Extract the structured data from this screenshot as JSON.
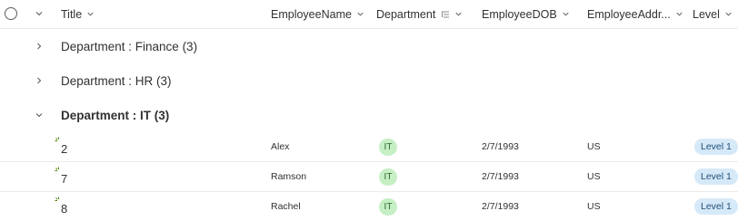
{
  "header": {
    "columns": [
      {
        "key": "title",
        "label": "Title"
      },
      {
        "key": "employee_name",
        "label": "EmployeeName"
      },
      {
        "key": "department",
        "label": "Department"
      },
      {
        "key": "employee_dob",
        "label": "EmployeeDOB"
      },
      {
        "key": "employee_address",
        "label": "EmployeeAddr..."
      },
      {
        "key": "level",
        "label": "Level"
      }
    ]
  },
  "groups": [
    {
      "label": "Department : Finance (3)",
      "expanded": false
    },
    {
      "label": "Department : HR (3)",
      "expanded": false
    },
    {
      "label": "Department : IT (3)",
      "expanded": true
    }
  ],
  "rows": [
    {
      "title": "2",
      "employee_name": "Alex",
      "department": "IT",
      "employee_dob": "2/7/1993",
      "employee_address": "US",
      "level": "Level 1"
    },
    {
      "title": "7",
      "employee_name": "Ramson",
      "department": "IT",
      "employee_dob": "2/7/1993",
      "employee_address": "US",
      "level": "Level 1"
    },
    {
      "title": "8",
      "employee_name": "Rachel",
      "department": "IT",
      "employee_dob": "2/7/1993",
      "employee_address": "US",
      "level": "Level 1"
    }
  ],
  "colors": {
    "department_pill_bg": "#c6efc6",
    "department_pill_text": "#2e6b2e",
    "level_pill_bg": "#d6e9f8",
    "level_pill_text": "#1f4e79",
    "divider": "#edebe9"
  }
}
